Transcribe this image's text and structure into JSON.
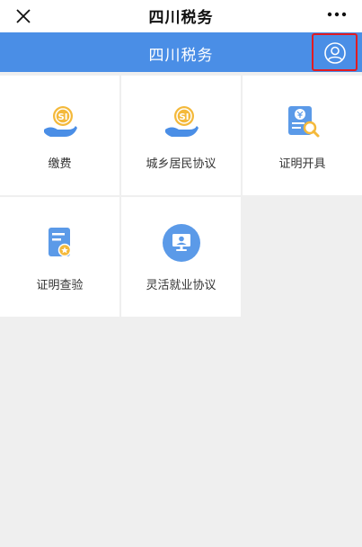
{
  "topbar": {
    "title": "四川税务",
    "close_icon": "close-icon",
    "more_icon": "more-dots-icon"
  },
  "header": {
    "title": "四川税务",
    "user_icon": "user-profile-icon",
    "bg_color": "#4a8ee6"
  },
  "tiles": [
    {
      "label": "缴费",
      "icon": "social-insurance-hand-icon"
    },
    {
      "label": "城乡居民协议",
      "icon": "social-insurance-hand-icon"
    },
    {
      "label": "证明开具",
      "icon": "certificate-search-icon"
    },
    {
      "label": "证明查验",
      "icon": "certificate-star-icon"
    },
    {
      "label": "灵活就业协议",
      "icon": "monitor-person-icon"
    }
  ]
}
